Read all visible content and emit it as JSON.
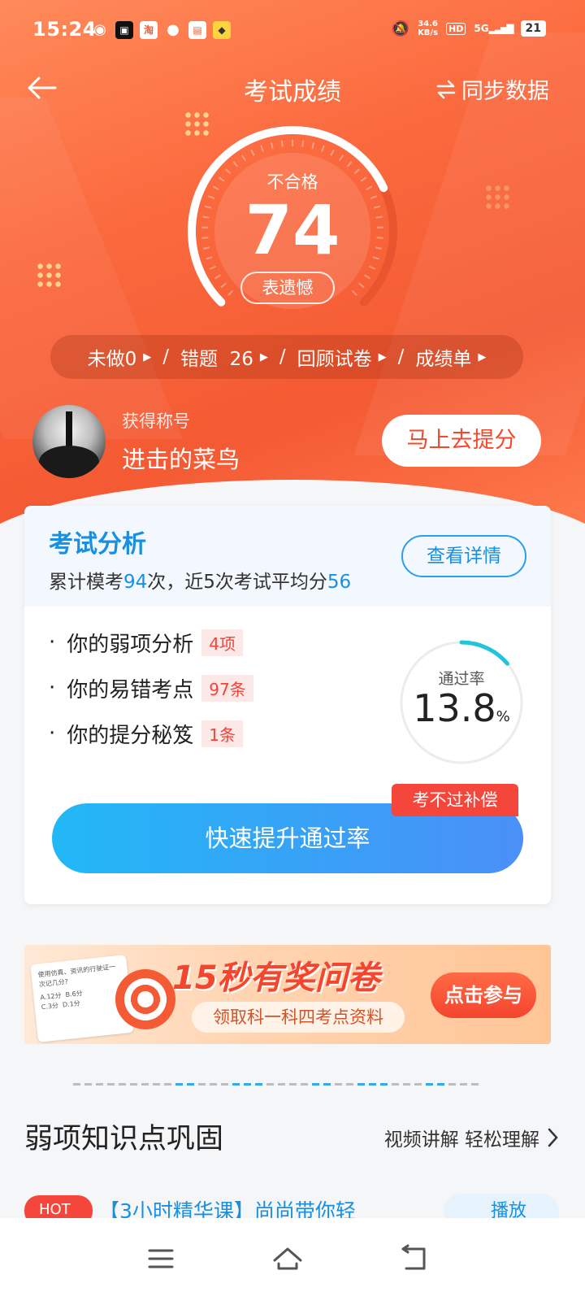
{
  "status_bar": {
    "time": "15:24",
    "app_icons": [
      "weibo-icon",
      "video-icon",
      "taobao-icon",
      "wechat-icon",
      "bilibili-icon",
      "app-icon"
    ],
    "taobao_char": "淘",
    "net_speed_value": "34.6",
    "net_speed_unit": "KB/s",
    "hd": "HD",
    "network": "5G",
    "battery": "21"
  },
  "nav": {
    "title": "考试成绩",
    "sync_label": "同步数据"
  },
  "score": {
    "status": "不合格",
    "value": "74",
    "regret_button": "表遗憾",
    "gauge_fraction": 0.74
  },
  "quick_links": {
    "undone": "未做0",
    "wrong": "错题  26",
    "review": "回顾试卷",
    "report": "成绩单",
    "separator": "/"
  },
  "title_row": {
    "label": "获得称号",
    "value": "进击的菜鸟",
    "boost_button": "马上去提分"
  },
  "analysis": {
    "title": "考试分析",
    "summary_prefix": "累计模考",
    "mock_count": "94",
    "summary_middle": "次，近5次考试平均分",
    "avg_score": "56",
    "detail_button": "查看详情",
    "items": [
      {
        "label": "你的弱项分析",
        "badge": "4项"
      },
      {
        "label": "你的易错考点",
        "badge": "97条"
      },
      {
        "label": "你的提分秘笈",
        "badge": "1条"
      }
    ],
    "pass_label": "通过率",
    "pass_value": "13.8",
    "pass_unit": "%",
    "pass_fraction": 0.138,
    "compensation_tag": "考不过补偿",
    "fast_button": "快速提升通过率"
  },
  "banner": {
    "title": "15秒有奖问卷",
    "subtitle": "领取科一科四考点资料",
    "button": "点击参与",
    "paper_text": "使用仿真、资讯的行驶证一次记几分?",
    "options": [
      "A.12分",
      "B.6分",
      "C.3分",
      "D.1分"
    ]
  },
  "weak_section": {
    "title": "弱项知识点巩固",
    "more": "视频讲解 轻松理解",
    "hot_tag": "HOT",
    "course_title": "【3小时精华课】尚尚带你轻",
    "play_label": "播放"
  },
  "colors": {
    "header_orange": "#f45a33",
    "accent_blue": "#1a8fe0",
    "alert_red": "#f5463b"
  }
}
